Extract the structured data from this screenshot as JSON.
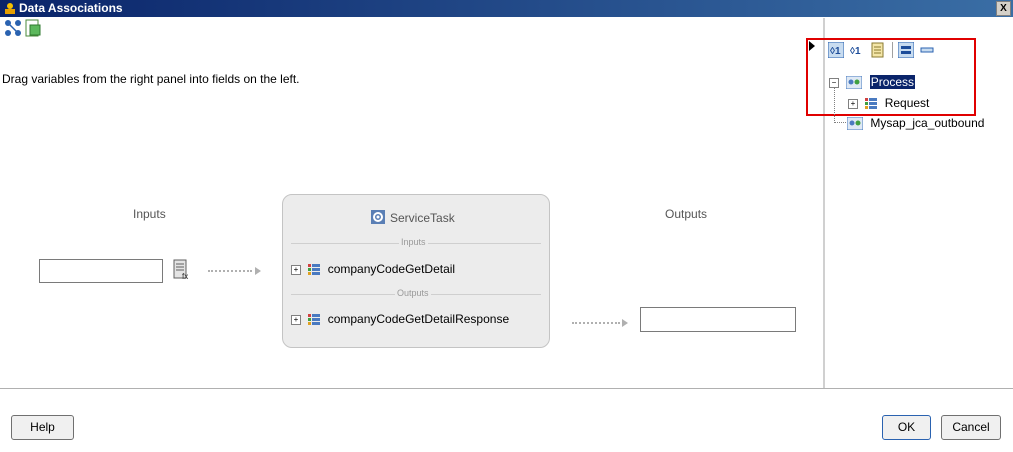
{
  "window": {
    "title": "Data Associations",
    "close_label": "X"
  },
  "toolbar": {
    "icons": [
      "mapping-icon",
      "expression-icon"
    ]
  },
  "hint": "Drag variables from the right panel into fields on the left.",
  "canvas": {
    "inputs_label": "Inputs",
    "outputs_label": "Outputs",
    "input_value": "",
    "output_value": "",
    "task": {
      "title": "ServiceTask",
      "inputs_section": "Inputs",
      "outputs_section": "Outputs",
      "input_item": "companyCodeGetDetail",
      "output_item": "companyCodeGetDetailResponse"
    }
  },
  "variables_tree": {
    "toolbar_icons": [
      "show-all-icon",
      "show-used-icon",
      "properties-icon",
      "view-icon",
      "collapse-icon"
    ],
    "nodes": [
      {
        "label": "Process",
        "selected": true
      },
      {
        "label": "Request"
      },
      {
        "label": "Mysap_jca_outbound"
      }
    ]
  },
  "buttons": {
    "help": "Help",
    "ok": "OK",
    "cancel": "Cancel"
  },
  "colors": {
    "highlight": "#e00000",
    "title_bar": "#0a246a"
  }
}
